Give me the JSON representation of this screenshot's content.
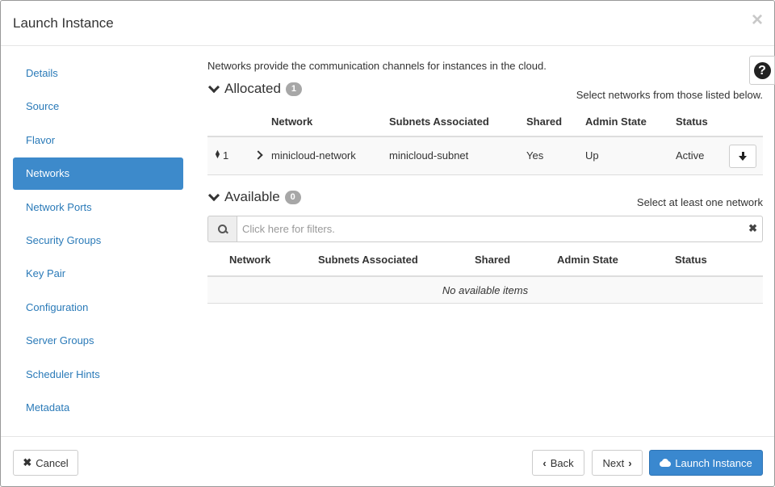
{
  "dialog": {
    "title": "Launch Instance",
    "close_glyph": "×"
  },
  "sidebar": {
    "items": [
      {
        "label": "Details"
      },
      {
        "label": "Source"
      },
      {
        "label": "Flavor"
      },
      {
        "label": "Networks",
        "active": true
      },
      {
        "label": "Network Ports"
      },
      {
        "label": "Security Groups"
      },
      {
        "label": "Key Pair"
      },
      {
        "label": "Configuration"
      },
      {
        "label": "Server Groups"
      },
      {
        "label": "Scheduler Hints"
      },
      {
        "label": "Metadata"
      }
    ]
  },
  "help_glyph": "?",
  "main": {
    "intro": "Networks provide the communication channels for instances in the cloud.",
    "allocated": {
      "title": "Allocated",
      "count": "1",
      "hint": "Select networks from those listed below.",
      "columns": [
        "Network",
        "Subnets Associated",
        "Shared",
        "Admin State",
        "Status"
      ],
      "rows": [
        {
          "order": "1",
          "network": "minicloud-network",
          "subnets": "minicloud-subnet",
          "shared": "Yes",
          "admin_state": "Up",
          "status": "Active"
        }
      ]
    },
    "available": {
      "title": "Available",
      "count": "0",
      "hint": "Select at least one network",
      "filter_placeholder": "Click here for filters.",
      "filter_clear_glyph": "✖",
      "columns": [
        "Network",
        "Subnets Associated",
        "Shared",
        "Admin State",
        "Status"
      ],
      "empty_text": "No available items"
    }
  },
  "footer": {
    "cancel_label": "Cancel",
    "cancel_glyph": "✖",
    "back_label": "Back",
    "back_glyph": "‹",
    "next_label": "Next",
    "next_glyph": "›",
    "launch_label": "Launch Instance"
  },
  "colors": {
    "accent": "#3d8acb",
    "link": "#2a7ab8",
    "badge": "#a7a7a7"
  }
}
